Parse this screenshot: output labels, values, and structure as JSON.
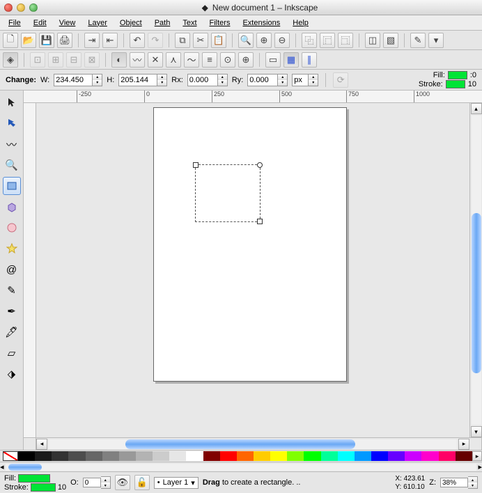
{
  "window": {
    "title": "New document 1 – Inkscape"
  },
  "menus": [
    "File",
    "Edit",
    "View",
    "Layer",
    "Object",
    "Path",
    "Text",
    "Filters",
    "Extensions",
    "Help"
  ],
  "option_bar": {
    "change_label": "Change:",
    "w_label": "W:",
    "w": "234.450",
    "h_label": "H:",
    "h": "205.144",
    "rx_label": "Rx:",
    "rx": "0.000",
    "ry_label": "Ry:",
    "ry": "0.000",
    "unit": "px"
  },
  "fill_stroke": {
    "fill_label": "Fill:",
    "stroke_label": "Stroke:",
    "stroke_width": "10",
    "trailing": ":0"
  },
  "ruler": {
    "ticks": [
      "-250",
      "0",
      "250",
      "500",
      "750",
      "1000"
    ]
  },
  "status": {
    "fill_label": "Fill:",
    "stroke_label": "Stroke:",
    "stroke_width": "10",
    "opacity_label": "O:",
    "opacity": "0",
    "layer": "Layer 1",
    "hint_bold": "Drag",
    "hint_rest": " to create a rectangle. ..",
    "x_label": "X:",
    "x": "423.61",
    "y_label": "Y:",
    "y": "610.10",
    "z_label": "Z:",
    "zoom": "38%"
  },
  "palette": [
    "#000000",
    "#1a1a1a",
    "#333333",
    "#4d4d4d",
    "#666666",
    "#808080",
    "#999999",
    "#b3b3b3",
    "#cccccc",
    "#e6e6e6",
    "#ffffff",
    "#800000",
    "#ff0000",
    "#ff6600",
    "#ffcc00",
    "#ffff00",
    "#80ff00",
    "#00ff00",
    "#00ff99",
    "#00ffff",
    "#0099ff",
    "#0000ff",
    "#6600ff",
    "#cc00ff",
    "#ff00cc",
    "#ff0066",
    "#660000"
  ]
}
